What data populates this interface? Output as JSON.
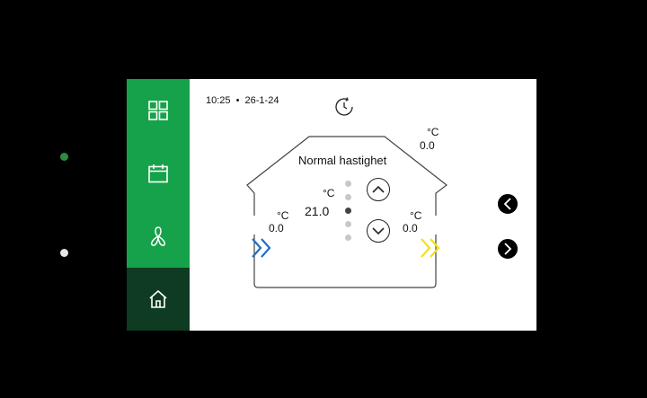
{
  "status": {
    "time": "10:25",
    "separator": "•",
    "date": "26-1-24"
  },
  "sidebar": {
    "items": [
      {
        "icon": "grid-icon"
      },
      {
        "icon": "calendar-icon"
      },
      {
        "icon": "fan-icon"
      },
      {
        "icon": "home-icon",
        "active": true
      }
    ],
    "color": "#16a24a",
    "active_color": "#0f3b22"
  },
  "house": {
    "mode_label": "Normal hastighet",
    "outdoor": {
      "unit": "°C",
      "value": "0.0"
    },
    "supply": {
      "unit": "°C",
      "value": "0.0"
    },
    "extract": {
      "unit": "°C",
      "value": "0.0"
    },
    "setpoint": {
      "unit": "°C",
      "value": "21.0"
    },
    "fan_levels": {
      "total": 5,
      "current": 3
    },
    "supply_arrow_color": "#1e6fc0",
    "extract_arrow_color": "#f2e21a"
  },
  "leds": {
    "top_color": "#2e8b3c",
    "bottom_color": "#e6e6e6"
  }
}
